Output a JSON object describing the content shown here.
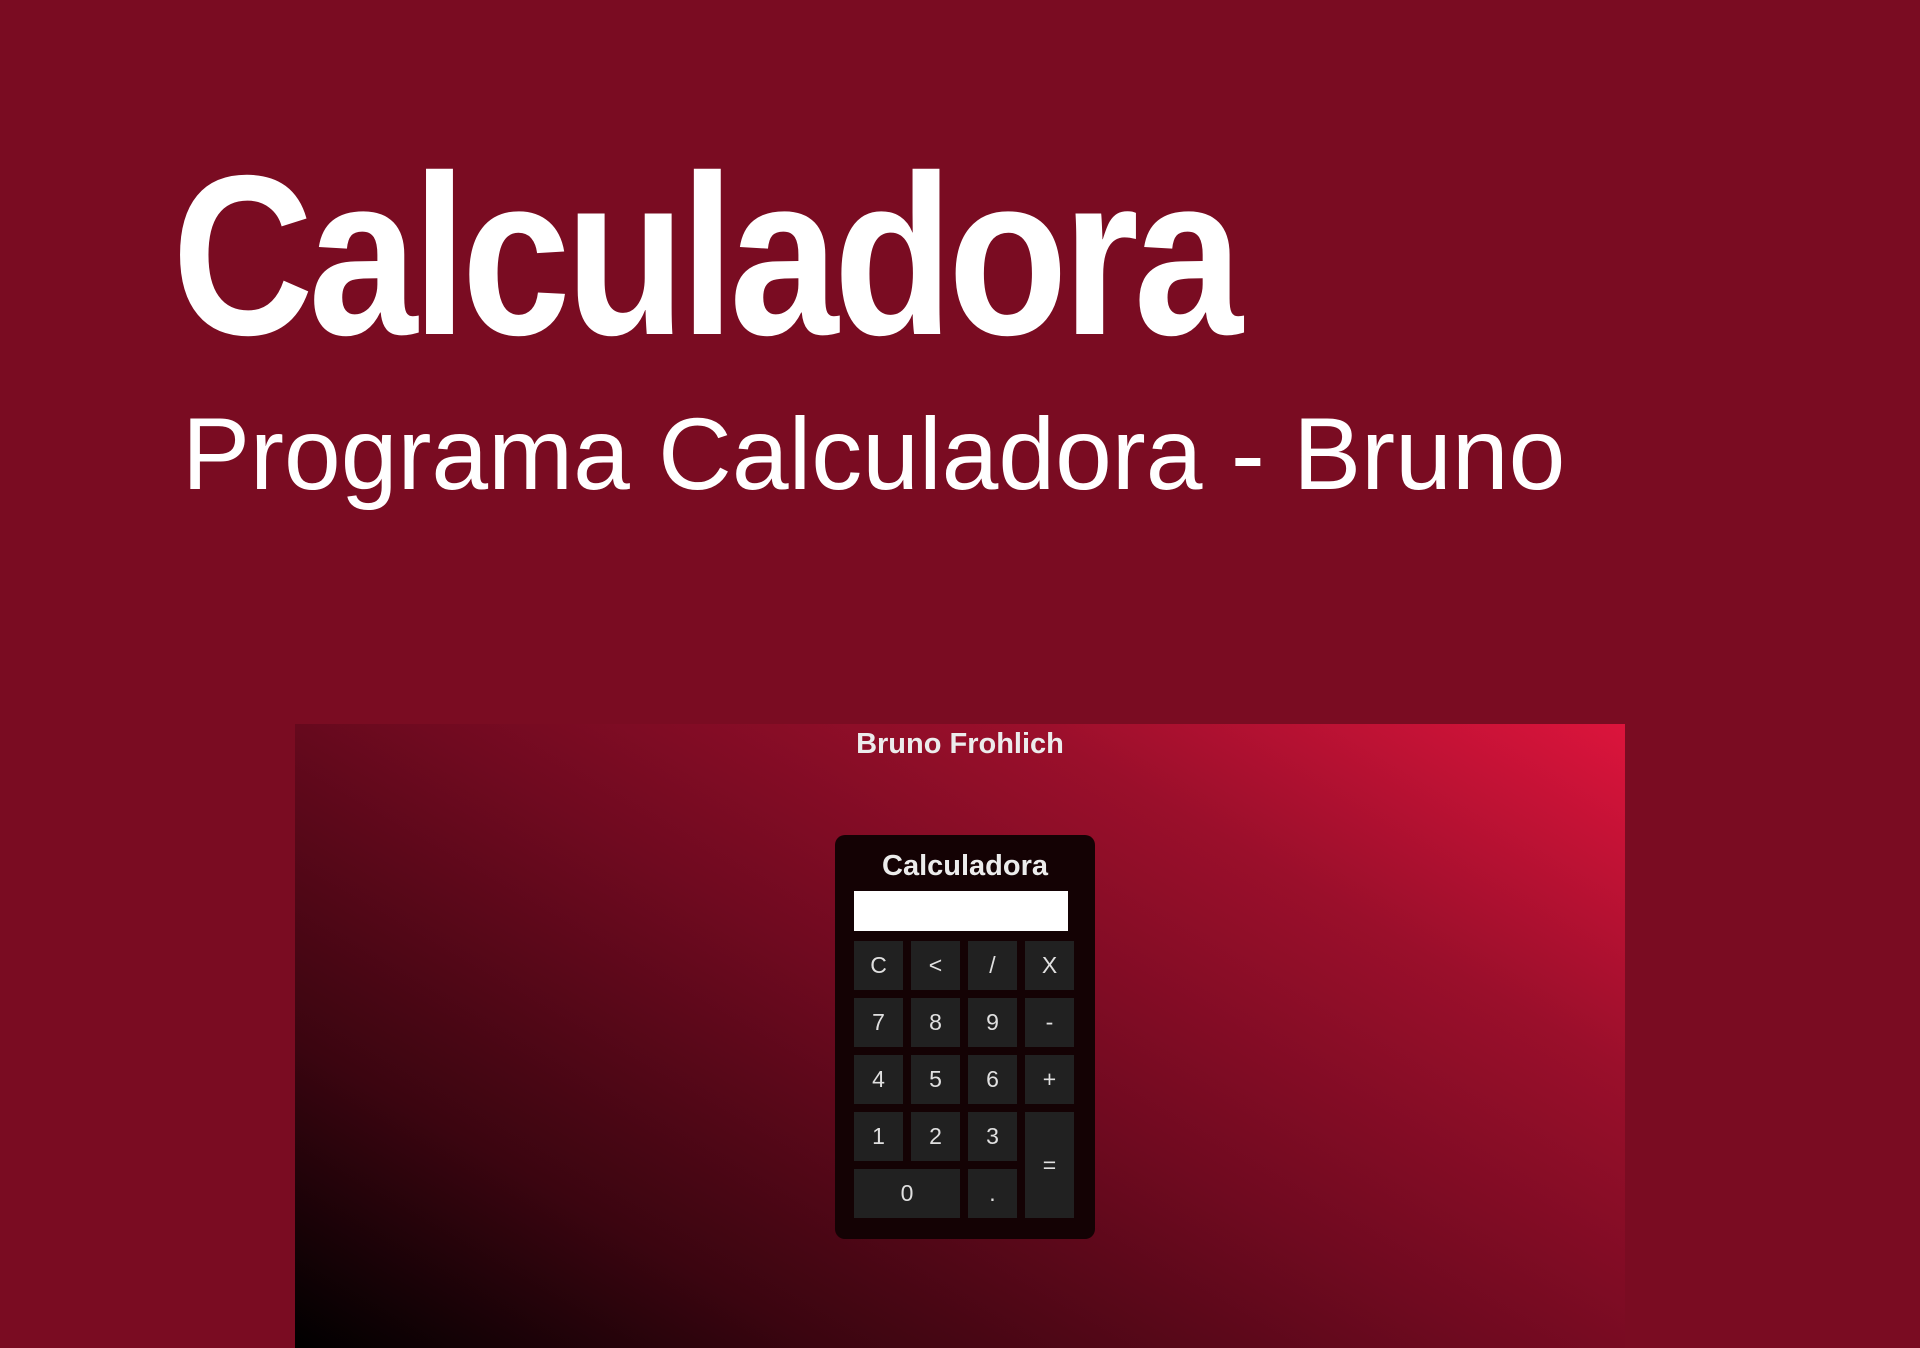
{
  "hero": {
    "title": "Calculadora",
    "subtitle": "Programa Calculadora - Bruno"
  },
  "preview": {
    "author": "Bruno Frohlich",
    "calculator": {
      "title": "Calculadora",
      "display_value": "",
      "keys": {
        "clear": "C",
        "backspace": "<",
        "divide": "/",
        "multiply": "X",
        "seven": "7",
        "eight": "8",
        "nine": "9",
        "minus": "-",
        "four": "4",
        "five": "5",
        "six": "6",
        "plus": "+",
        "one": "1",
        "two": "2",
        "three": "3",
        "equals": "=",
        "zero": "0",
        "decimal": "."
      }
    }
  },
  "colors": {
    "page_background": "#7a0c22",
    "calculator_background": "#140204",
    "key_background": "#212121",
    "gradient_start": "#000000",
    "gradient_end": "#dc143c"
  }
}
